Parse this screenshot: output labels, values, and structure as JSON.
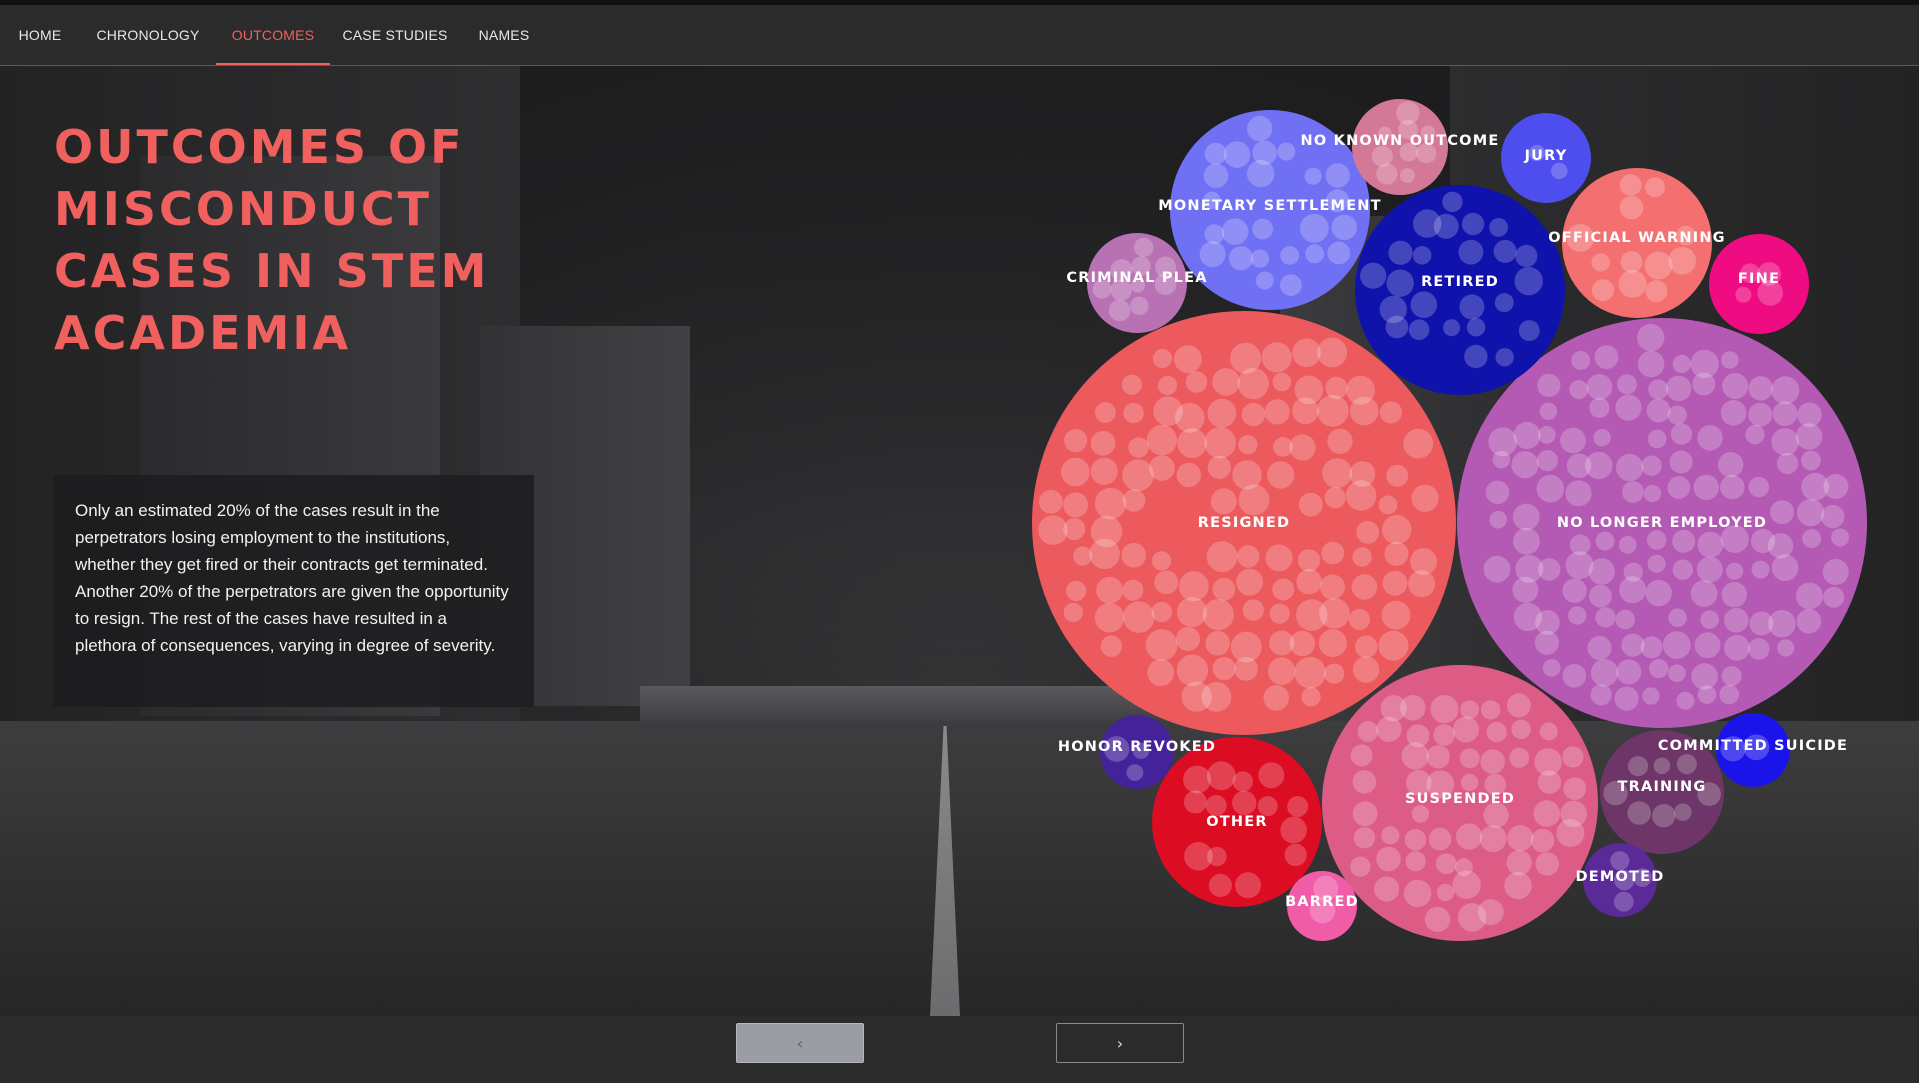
{
  "nav": {
    "items": [
      {
        "label": "HOME"
      },
      {
        "label": "CHRONOLOGY"
      },
      {
        "label": "OUTCOMES"
      },
      {
        "label": "CASE STUDIES"
      },
      {
        "label": "NAMES"
      }
    ],
    "active": "OUTCOMES"
  },
  "main": {
    "title_lines": [
      "OUTCOMES OF",
      "MISCONDUCT",
      "CASES IN STEM",
      "ACADEMIA"
    ],
    "description": "Only an estimated 20% of the cases result in the perpetrators losing employment to the institutions, whether they get fired or their contracts get terminated. Another 20% of the perpetrators are given the opportunity to resign. The rest of the cases have resulted in a plethora of consequences, varying in degree of severity."
  },
  "colors": {
    "accent": "#f0605e",
    "nav_bg": "#2b2b2c",
    "text": "#f2f2f2"
  },
  "bubbles": [
    {
      "label": "NO LONGER EMPLOYED",
      "color": "#b45ab4"
    },
    {
      "label": "RESIGNED",
      "color": "#ec5a5e"
    },
    {
      "label": "SUSPENDED",
      "color": "#dc5c86"
    },
    {
      "label": "MONETARY SETTLEMENT",
      "color": "#7070f4"
    },
    {
      "label": "RETIRED",
      "color": "#1012ac"
    },
    {
      "label": "OFFICIAL WARNING",
      "color": "#f47070"
    },
    {
      "label": "OTHER",
      "color": "#dc0c22"
    },
    {
      "label": "NO KNOWN OUTCOME",
      "color": "#d47898"
    },
    {
      "label": "TRAINING",
      "color": "#6e3668"
    },
    {
      "label": "CRIMINAL PLEA",
      "color": "#b872b4"
    },
    {
      "label": "JURY",
      "color": "#4e4eee"
    },
    {
      "label": "FINE",
      "color": "#ef0c82"
    },
    {
      "label": "HONOR REVOKED",
      "color": "#44229a"
    },
    {
      "label": "COMMITTED SUICIDE",
      "color": "#1a14ea"
    },
    {
      "label": "DEMOTED",
      "color": "#5a2a98"
    },
    {
      "label": "BARRED",
      "color": "#f05ca8"
    }
  ],
  "pagination": {
    "prev_icon": "chevron-left-icon",
    "next_icon": "chevron-right-icon",
    "prev_glyph": "‹",
    "next_glyph": "›"
  }
}
